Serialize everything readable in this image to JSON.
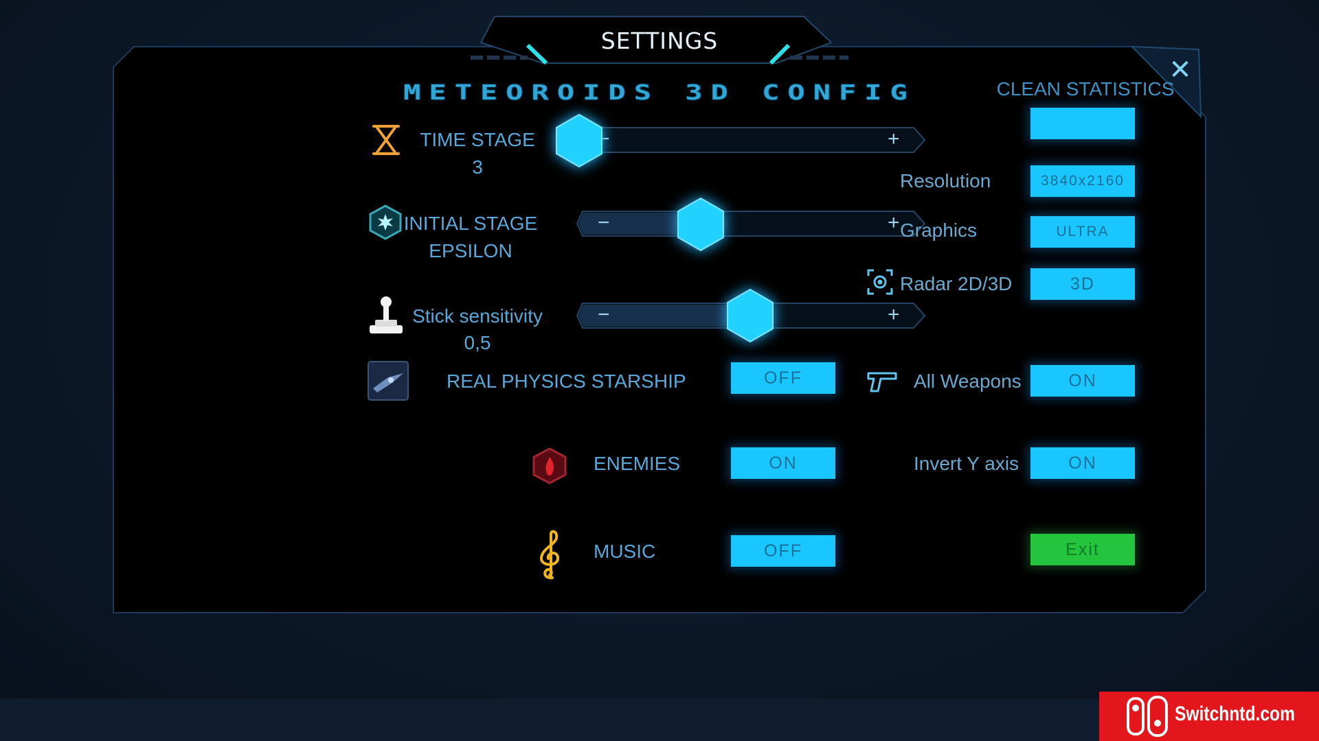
{
  "window": {
    "title": "SETTINGS",
    "close_symbol": "✕"
  },
  "header": {
    "game_title": "METEOROIDS 3D CONFIG"
  },
  "sliders": [
    {
      "label": "TIME STAGE",
      "value": "3",
      "minus": "−",
      "plus": "+",
      "level": 0.0
    },
    {
      "label": "INITIAL STAGE",
      "value": "EPSILON",
      "minus": "−",
      "plus": "+",
      "level": 0.35
    },
    {
      "label": "Stick sensitivity",
      "value": "0,5",
      "minus": "−",
      "plus": "+",
      "level": 0.5
    }
  ],
  "left_toggles": [
    {
      "label": "REAL PHYSICS STARSHIP",
      "value": "OFF",
      "icon": "starship-icon"
    },
    {
      "label": "ENEMIES",
      "value": "ON",
      "icon": "enemy-hexagon-icon"
    },
    {
      "label": "MUSIC",
      "value": "OFF",
      "icon": "treble-clef-icon"
    }
  ],
  "right_panel": {
    "clean_statistics": {
      "label": "CLEAN STATISTICS",
      "value": ""
    },
    "resolution": {
      "label": "Resolution",
      "value": "3840x2160"
    },
    "graphics": {
      "label": "Graphics",
      "value": "ULTRA"
    },
    "radar": {
      "label": "Radar 2D/3D",
      "value": "3D",
      "icon": "radar-target-icon"
    },
    "all_weapons": {
      "label": "All Weapons",
      "value": "ON",
      "icon": "pistol-icon"
    },
    "invert_y": {
      "label": "Invert Y axis",
      "value": "ON"
    },
    "exit": {
      "label": "Exit"
    }
  },
  "watermark": {
    "text": "Switchntd.com",
    "icon": "nintendo-switch-logo-icon"
  },
  "colors": {
    "button_cyan": "#19c6ff",
    "button_green": "#24c43c",
    "accent_teal": "#2fa7d8",
    "panel_bg": "#000000",
    "watermark_red": "#e3161c"
  }
}
